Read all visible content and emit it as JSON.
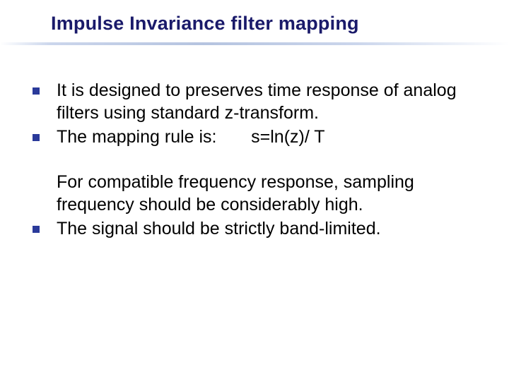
{
  "title": "Impulse Invariance filter mapping",
  "group1": {
    "item1": "It  is designed to preserves time response of analog filters using standard z-transform.",
    "item2_prefix": "The mapping rule is:",
    "item2_formula": "       s=ln(z)/ T"
  },
  "group2": {
    "line1": " For compatible frequency response, sampling frequency should be considerably high.",
    "item3": "The signal should be strictly band-limited."
  }
}
